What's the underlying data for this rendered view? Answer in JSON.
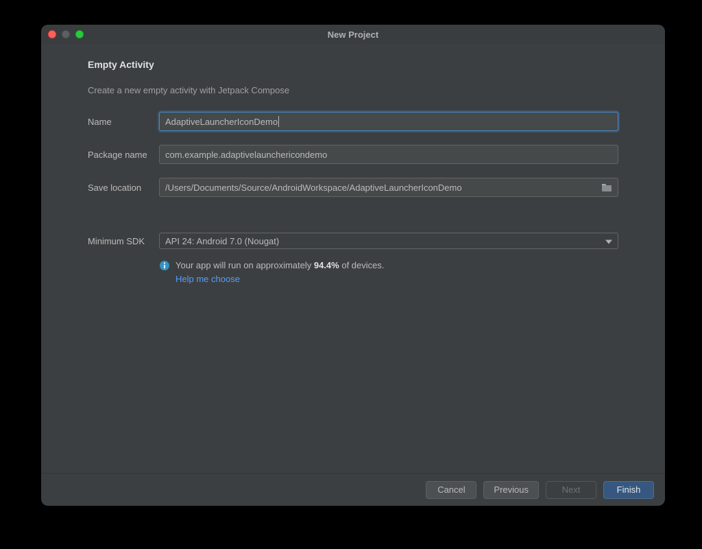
{
  "window": {
    "title": "New Project"
  },
  "heading": "Empty Activity",
  "subheading": "Create a new empty activity with Jetpack Compose",
  "fields": {
    "name": {
      "label": "Name",
      "value": "AdaptiveLauncherIconDemo"
    },
    "package": {
      "label": "Package name",
      "value": "com.example.adaptivelaunchericondemo"
    },
    "location": {
      "label": "Save location",
      "value": "/Users/Documents/Source/AndroidWorkspace/AdaptiveLauncherIconDemo"
    },
    "minsdk": {
      "label": "Minimum SDK",
      "value": "API 24: Android 7.0 (Nougat)"
    }
  },
  "info": {
    "prefix": "Your app will run on approximately ",
    "percent": "94.4%",
    "suffix": " of devices.",
    "link": "Help me choose"
  },
  "buttons": {
    "cancel": "Cancel",
    "previous": "Previous",
    "next": "Next",
    "finish": "Finish"
  }
}
